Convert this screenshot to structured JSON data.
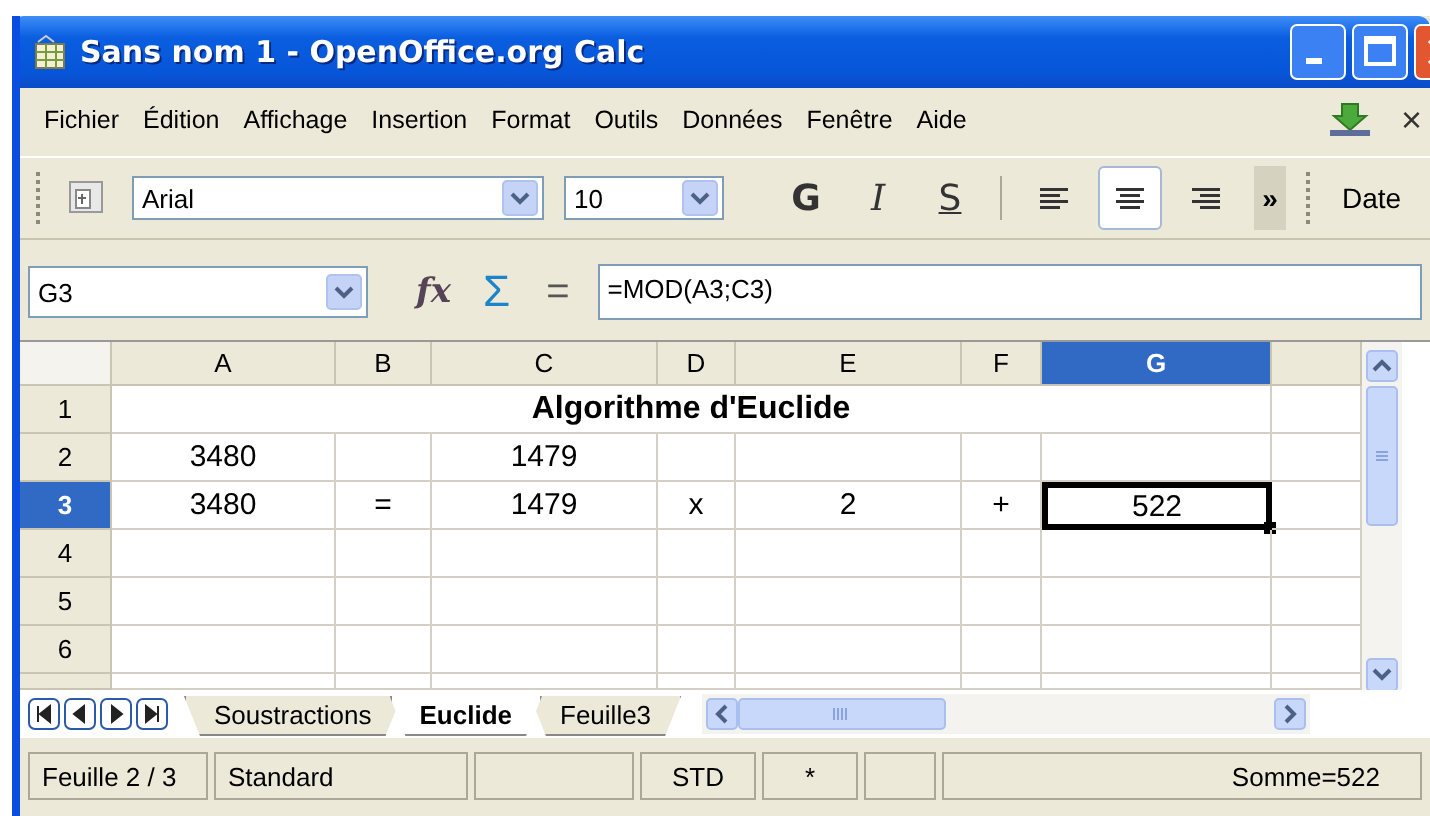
{
  "window": {
    "title": "Sans nom 1 - OpenOffice.org Calc"
  },
  "menu": [
    "Fichier",
    "Édition",
    "Affichage",
    "Insertion",
    "Format",
    "Outils",
    "Données",
    "Fenêtre",
    "Aide"
  ],
  "menu_close": "×",
  "toolbar": {
    "font": "Arial",
    "size": "10",
    "styles": [
      {
        "label": "G",
        "kind": "bold"
      },
      {
        "label": "I",
        "kind": "italic"
      },
      {
        "label": "S",
        "kind": "underline"
      }
    ],
    "align": [
      {
        "kind": "left",
        "selected": false
      },
      {
        "kind": "center",
        "selected": true
      },
      {
        "kind": "right",
        "selected": false
      }
    ],
    "overflow": "»",
    "date": "Date"
  },
  "formula_bar": {
    "cell": "G3",
    "function": "fx",
    "sum": "Σ",
    "equals": "=",
    "formula": "=MOD(A3;C3)"
  },
  "columns": [
    {
      "label": "A",
      "selected": false
    },
    {
      "label": "B",
      "selected": false
    },
    {
      "label": "C",
      "selected": false
    },
    {
      "label": "D",
      "selected": false
    },
    {
      "label": "E",
      "selected": false
    },
    {
      "label": "F",
      "selected": false
    },
    {
      "label": "G",
      "selected": true
    },
    {
      "selected": false
    }
  ],
  "rows": [
    {
      "label": "1",
      "selected": false,
      "cells": [
        {
          "text": "Algorithme d'Euclide",
          "kind": "title",
          "selected": false
        },
        {
          "selected": false
        }
      ]
    },
    {
      "label": "2",
      "selected": false,
      "cells": [
        {
          "text": "3480",
          "selected": false
        },
        {
          "selected": false
        },
        {
          "text": "1479",
          "selected": false
        },
        {
          "selected": false
        },
        {
          "selected": false
        },
        {
          "selected": false
        },
        {
          "selected": false
        },
        {
          "selected": false
        }
      ]
    },
    {
      "label": "3",
      "selected": true,
      "cells": [
        {
          "text": "3480",
          "selected": false
        },
        {
          "text": "=",
          "selected": false
        },
        {
          "text": "1479",
          "selected": false
        },
        {
          "text": "x",
          "selected": false
        },
        {
          "text": "2",
          "selected": false
        },
        {
          "text": "+",
          "selected": false
        },
        {
          "text": "522",
          "selected": true
        },
        {
          "selected": false
        }
      ]
    },
    {
      "label": "4",
      "selected": false,
      "cells": [
        {
          "selected": false
        },
        {
          "selected": false
        },
        {
          "selected": false
        },
        {
          "selected": false
        },
        {
          "selected": false
        },
        {
          "selected": false
        },
        {
          "selected": false
        },
        {
          "selected": false
        }
      ]
    },
    {
      "label": "5",
      "selected": false,
      "cells": [
        {
          "selected": false
        },
        {
          "selected": false
        },
        {
          "selected": false
        },
        {
          "selected": false
        },
        {
          "selected": false
        },
        {
          "selected": false
        },
        {
          "selected": false
        },
        {
          "selected": false
        }
      ]
    },
    {
      "label": "6",
      "selected": false,
      "cells": [
        {
          "selected": false
        },
        {
          "selected": false
        },
        {
          "selected": false
        },
        {
          "selected": false
        },
        {
          "selected": false
        },
        {
          "selected": false
        },
        {
          "selected": false
        },
        {
          "selected": false
        }
      ]
    }
  ],
  "sheet_tabs": [
    {
      "label": "Soustractions",
      "selected": false
    },
    {
      "label": "Euclide",
      "selected": true
    },
    {
      "label": "Feuille3",
      "selected": false
    }
  ],
  "status_bar": [
    {
      "kind": "text",
      "text": "Feuille 2 / 3"
    },
    {
      "kind": "text",
      "text": "Standard"
    },
    {
      "kind": "empty"
    },
    {
      "kind": "text",
      "text": "STD"
    },
    {
      "kind": "text",
      "text": "*"
    },
    {
      "kind": "empty"
    },
    {
      "kind": "text",
      "text": "Somme=522"
    }
  ]
}
